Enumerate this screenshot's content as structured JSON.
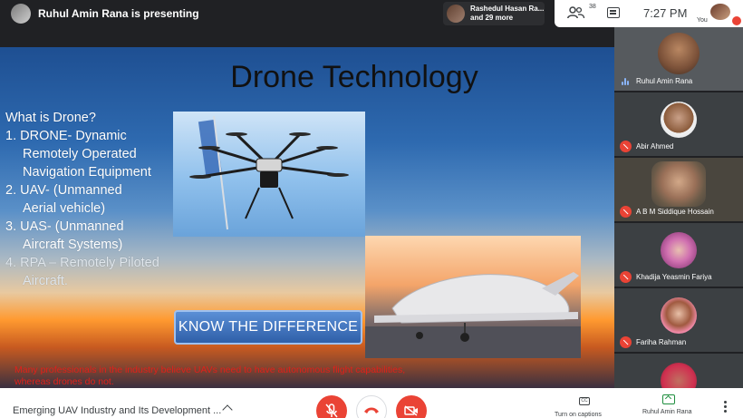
{
  "topbar": {
    "presenter_status": "Ruhul Amin Rana is presenting",
    "participants_chip": {
      "line1": "Rashedul Hasan Ra...",
      "line2": "and 29 more"
    },
    "people_count": "38",
    "clock": "7:27 PM",
    "self_label": "You"
  },
  "slide": {
    "title": "Drone Technology",
    "heading": "What is Drone?",
    "items": [
      {
        "line1": "1.  DRONE- Dynamic",
        "line2": "Remotely Operated",
        "line3": "Navigation Equipment"
      },
      {
        "line1": "2.   UAV- (Unmanned",
        "line2": "Aerial vehicle)"
      },
      {
        "line1": "3.  UAS- (Unmanned",
        "line2": "Aircraft Systems)"
      },
      {
        "line1": "4.  RPA – Remotely Piloted",
        "line2": "Aircraft."
      }
    ],
    "button_label": "KNOW THE DIFFERENCE",
    "note_line1": "Many professionals in the industry believe UAVs need to have autonomous flight capabilities,",
    "note_line2": "whereas drones do not."
  },
  "participants": [
    {
      "name": "Ruhul Amin Rana",
      "muted": false
    },
    {
      "name": "Abir Ahmed",
      "muted": true
    },
    {
      "name": "A B M Siddique Hossain",
      "muted": true
    },
    {
      "name": "Khadija Yeasmin Fariya",
      "muted": true
    },
    {
      "name": "Fariha Rahman",
      "muted": true
    },
    {
      "name": "",
      "muted": true
    }
  ],
  "bottombar": {
    "meeting_title": "Emerging UAV Industry and Its Development ...",
    "captions_label": "Turn on captions",
    "presenter_label": "Ruhul Amin Rana",
    "cc_text": "CC"
  },
  "colors": {
    "mute_red": "#ea4335",
    "present_green": "#1e8e3e",
    "slide_note_red": "#e0201a"
  }
}
